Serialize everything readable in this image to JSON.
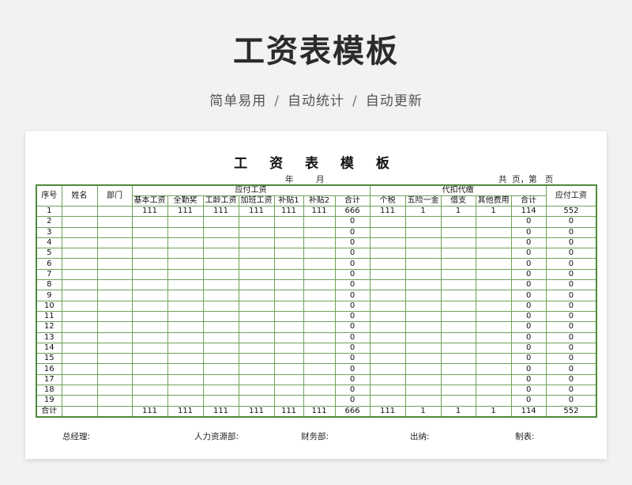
{
  "hero": {
    "title": "工资表模板",
    "subtitle_parts": [
      "简单易用",
      "自动统计",
      "自动更新"
    ],
    "separator": "/"
  },
  "sheet": {
    "title": "工 资 表 模 板",
    "year_label": "年",
    "month_label": "月",
    "page_info": "共  页，第   页"
  },
  "headers": {
    "seq": "序号",
    "name": "姓名",
    "dept": "部门",
    "payable_group": "应付工资",
    "payable_cols": [
      "基本工资",
      "全勤奖",
      "工龄工资",
      "加班工资",
      "补贴1",
      "补贴2",
      "合计"
    ],
    "deduct_group": "代扣代缴",
    "deduct_cols": [
      "个税",
      "五险一金",
      "借支",
      "其他费用",
      "合计"
    ],
    "net_pay": "应付工资"
  },
  "rows": [
    {
      "seq": "1",
      "payable": [
        "111",
        "111",
        "111",
        "111",
        "111",
        "111",
        "666"
      ],
      "deduct": [
        "111",
        "1",
        "1",
        "1",
        "114"
      ],
      "net": "552"
    },
    {
      "seq": "2",
      "payable": [
        "",
        "",
        "",
        "",
        "",
        "",
        "0"
      ],
      "deduct": [
        "",
        "",
        "",
        "",
        "0"
      ],
      "net": "0"
    },
    {
      "seq": "3",
      "payable": [
        "",
        "",
        "",
        "",
        "",
        "",
        "0"
      ],
      "deduct": [
        "",
        "",
        "",
        "",
        "0"
      ],
      "net": "0"
    },
    {
      "seq": "4",
      "payable": [
        "",
        "",
        "",
        "",
        "",
        "",
        "0"
      ],
      "deduct": [
        "",
        "",
        "",
        "",
        "0"
      ],
      "net": "0"
    },
    {
      "seq": "5",
      "payable": [
        "",
        "",
        "",
        "",
        "",
        "",
        "0"
      ],
      "deduct": [
        "",
        "",
        "",
        "",
        "0"
      ],
      "net": "0"
    },
    {
      "seq": "6",
      "payable": [
        "",
        "",
        "",
        "",
        "",
        "",
        "0"
      ],
      "deduct": [
        "",
        "",
        "",
        "",
        "0"
      ],
      "net": "0"
    },
    {
      "seq": "7",
      "payable": [
        "",
        "",
        "",
        "",
        "",
        "",
        "0"
      ],
      "deduct": [
        "",
        "",
        "",
        "",
        "0"
      ],
      "net": "0"
    },
    {
      "seq": "8",
      "payable": [
        "",
        "",
        "",
        "",
        "",
        "",
        "0"
      ],
      "deduct": [
        "",
        "",
        "",
        "",
        "0"
      ],
      "net": "0"
    },
    {
      "seq": "9",
      "payable": [
        "",
        "",
        "",
        "",
        "",
        "",
        "0"
      ],
      "deduct": [
        "",
        "",
        "",
        "",
        "0"
      ],
      "net": "0"
    },
    {
      "seq": "10",
      "payable": [
        "",
        "",
        "",
        "",
        "",
        "",
        "0"
      ],
      "deduct": [
        "",
        "",
        "",
        "",
        "0"
      ],
      "net": "0"
    },
    {
      "seq": "11",
      "payable": [
        "",
        "",
        "",
        "",
        "",
        "",
        "0"
      ],
      "deduct": [
        "",
        "",
        "",
        "",
        "0"
      ],
      "net": "0"
    },
    {
      "seq": "12",
      "payable": [
        "",
        "",
        "",
        "",
        "",
        "",
        "0"
      ],
      "deduct": [
        "",
        "",
        "",
        "",
        "0"
      ],
      "net": "0"
    },
    {
      "seq": "13",
      "payable": [
        "",
        "",
        "",
        "",
        "",
        "",
        "0"
      ],
      "deduct": [
        "",
        "",
        "",
        "",
        "0"
      ],
      "net": "0"
    },
    {
      "seq": "14",
      "payable": [
        "",
        "",
        "",
        "",
        "",
        "",
        "0"
      ],
      "deduct": [
        "",
        "",
        "",
        "",
        "0"
      ],
      "net": "0"
    },
    {
      "seq": "15",
      "payable": [
        "",
        "",
        "",
        "",
        "",
        "",
        "0"
      ],
      "deduct": [
        "",
        "",
        "",
        "",
        "0"
      ],
      "net": "0"
    },
    {
      "seq": "16",
      "payable": [
        "",
        "",
        "",
        "",
        "",
        "",
        "0"
      ],
      "deduct": [
        "",
        "",
        "",
        "",
        "0"
      ],
      "net": "0"
    },
    {
      "seq": "17",
      "payable": [
        "",
        "",
        "",
        "",
        "",
        "",
        "0"
      ],
      "deduct": [
        "",
        "",
        "",
        "",
        "0"
      ],
      "net": "0"
    },
    {
      "seq": "18",
      "payable": [
        "",
        "",
        "",
        "",
        "",
        "",
        "0"
      ],
      "deduct": [
        "",
        "",
        "",
        "",
        "0"
      ],
      "net": "0"
    },
    {
      "seq": "19",
      "payable": [
        "",
        "",
        "",
        "",
        "",
        "",
        "0"
      ],
      "deduct": [
        "",
        "",
        "",
        "",
        "0"
      ],
      "net": "0"
    }
  ],
  "total_row": {
    "label": "合计",
    "payable": [
      "111",
      "111",
      "111",
      "111",
      "111",
      "111",
      "666"
    ],
    "deduct": [
      "111",
      "1",
      "1",
      "1",
      "114"
    ],
    "net": "552"
  },
  "footer": {
    "manager": "总经理:",
    "hr": "人力资源部:",
    "finance": "财务部:",
    "cashier": "出纳:",
    "preparer": "制表:"
  },
  "colors": {
    "grid_line": "#6fa25a",
    "grid_border": "#4e8a3a",
    "page_bg": "#f1f2f4"
  }
}
